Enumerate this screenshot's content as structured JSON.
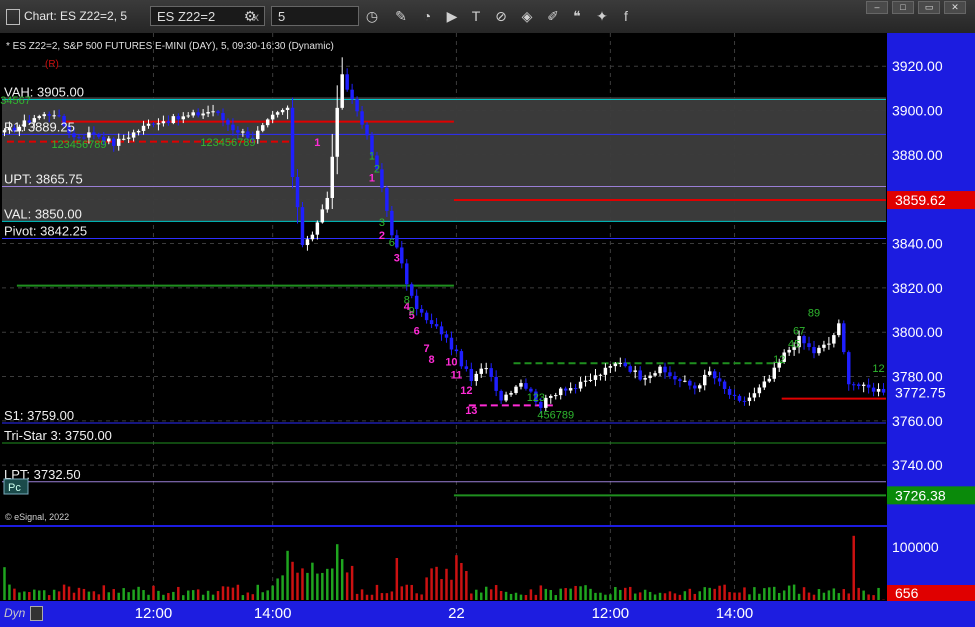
{
  "window": {
    "title": "Chart: ES Z22=2, 5",
    "symbol_field": "ES Z22=2",
    "interval_field": "5",
    "close_x": "x"
  },
  "header": {
    "description": "* ES Z22=2, S&P 500 FUTURES E-MINI (DAY), 5, 09:30-16:30 (Dynamic)",
    "r_marker": "(R)",
    "copyright": "© eSignal, 2022",
    "pc_button": "Pc"
  },
  "status": {
    "dyn_label": "Dyn"
  },
  "colors": {
    "background": "#000000",
    "axis_blue": "#1c1ce0",
    "price_red": "#e00000",
    "price_green": "#0a8a0a",
    "candle_up": "#ffffff",
    "candle_down": "#1f1fff",
    "green_label": "#2fb82f",
    "magenta_label": "#ff2bd6"
  },
  "chart_data": {
    "type": "candlestick",
    "ylim": [
      3713,
      3935
    ],
    "volume_ylim": [
      0,
      120000
    ],
    "y_ticks": [
      3920,
      3900,
      3880,
      3860,
      3840,
      3820,
      3800,
      3780,
      3760,
      3740
    ],
    "y_tick_labels": [
      "3920.00",
      "3900.00",
      "3880.00",
      "3840.00",
      "3820.00",
      "3800.00",
      "3780.00",
      "3760.00",
      "3740.00"
    ],
    "volume_tick_label": "100000",
    "x_labels": [
      {
        "label": "12:00",
        "bar": 30
      },
      {
        "label": "14:00",
        "bar": 54
      },
      {
        "label": "22",
        "bar": 91
      },
      {
        "label": "12:00",
        "bar": 122
      },
      {
        "label": "14:00",
        "bar": 147
      }
    ],
    "session_break_bar": 91,
    "n_bars": 178,
    "last_price": "3859.62",
    "last_price_value": 3859.62,
    "low_price": "3726.38",
    "low_price_value": 3726.38,
    "current_price": "3772.75",
    "current_price_value": 3772.75,
    "current_volume": "656",
    "anchors": [
      [
        0,
        3890
      ],
      [
        3,
        3893
      ],
      [
        6,
        3897
      ],
      [
        10,
        3899
      ],
      [
        14,
        3888
      ],
      [
        18,
        3890
      ],
      [
        22,
        3885
      ],
      [
        26,
        3890
      ],
      [
        30,
        3895
      ],
      [
        34,
        3896
      ],
      [
        38,
        3898
      ],
      [
        42,
        3900
      ],
      [
        46,
        3892
      ],
      [
        50,
        3888
      ],
      [
        54,
        3897
      ],
      [
        57,
        3901
      ],
      [
        58,
        3870
      ],
      [
        60,
        3840
      ],
      [
        62,
        3845
      ],
      [
        65,
        3860
      ],
      [
        67,
        3900
      ],
      [
        68,
        3915
      ],
      [
        70,
        3905
      ],
      [
        72,
        3895
      ],
      [
        74,
        3880
      ],
      [
        76,
        3865
      ],
      [
        78,
        3845
      ],
      [
        80,
        3830
      ],
      [
        82,
        3815
      ],
      [
        85,
        3805
      ],
      [
        88,
        3800
      ],
      [
        91,
        3790
      ],
      [
        94,
        3778
      ],
      [
        97,
        3785
      ],
      [
        100,
        3770
      ],
      [
        104,
        3778
      ],
      [
        108,
        3767
      ],
      [
        112,
        3775
      ],
      [
        115,
        3775
      ],
      [
        119,
        3780
      ],
      [
        124,
        3787
      ],
      [
        128,
        3780
      ],
      [
        132,
        3783
      ],
      [
        136,
        3778
      ],
      [
        139,
        3775
      ],
      [
        142,
        3782
      ],
      [
        145,
        3774
      ],
      [
        148,
        3768
      ],
      [
        151,
        3772
      ],
      [
        154,
        3779
      ],
      [
        157,
        3790
      ],
      [
        160,
        3797
      ],
      [
        163,
        3791
      ],
      [
        166,
        3795
      ],
      [
        168,
        3803
      ],
      [
        170,
        3778
      ],
      [
        173,
        3775
      ],
      [
        176,
        3774
      ],
      [
        177,
        3772.75
      ]
    ],
    "levels": [
      {
        "name": "VAH",
        "label": "VAH: 3905.00",
        "value": 3905.0,
        "color": "#00c8c8",
        "label_side": "left"
      },
      {
        "name": "R1",
        "label": "R1: 3889.25",
        "value": 3889.25,
        "color": "#2d2dff",
        "label_side": "left"
      },
      {
        "name": "UPT",
        "label": "UPT: 3865.75",
        "value": 3865.75,
        "color": "#9a7fd6",
        "label_side": "left"
      },
      {
        "name": "VAL",
        "label": "VAL: 3850.00",
        "value": 3850.0,
        "color": "#00c8c8",
        "label_side": "left"
      },
      {
        "name": "Pivot",
        "label": "Pivot: 3842.25",
        "value": 3842.25,
        "color": "#2d2dff",
        "label_side": "left"
      },
      {
        "name": "S1",
        "label": "S1: 3759.00",
        "value": 3759.0,
        "color": "#2d2dff",
        "label_side": "left"
      },
      {
        "name": "TriStar",
        "label": "Tri-Star 3: 3750.00",
        "value": 3750.0,
        "color": "#1f8f1f",
        "label_side": "left"
      },
      {
        "name": "LPT",
        "label": "LPT: 3732.50",
        "value": 3732.5,
        "color": "#9a7fd6",
        "label_side": "left"
      }
    ],
    "segments": [
      {
        "value": 3895,
        "from_bar": 12,
        "to_bar": 91,
        "color": "#e00000",
        "dash": false
      },
      {
        "value": 3886,
        "from_bar": 1,
        "to_bar": 58,
        "color": "#e00000",
        "dash": true
      },
      {
        "value": 3859.62,
        "from_bar": 91,
        "to_bar": 178,
        "color": "#e00000",
        "dash": false
      },
      {
        "value": 3821,
        "from_bar": 3,
        "to_bar": 91,
        "color": "#1f8f1f",
        "dash": false
      },
      {
        "value": 3786,
        "from_bar": 103,
        "to_bar": 157,
        "color": "#1f8f1f",
        "dash": true
      },
      {
        "value": 3767,
        "from_bar": 94,
        "to_bar": 111,
        "color": "#ff2bd6",
        "dash": true
      },
      {
        "value": 3770,
        "from_bar": 157,
        "to_bar": 178,
        "color": "#e00000",
        "dash": false
      },
      {
        "value": 3726.38,
        "from_bar": 91,
        "to_bar": 178,
        "color": "#1f8f1f",
        "dash": false
      }
    ],
    "seq_labels": [
      {
        "text": "1",
        "bar": 63,
        "value": 3884,
        "color": "#ff2bd6"
      },
      {
        "text": "1",
        "bar": 74,
        "value": 3868,
        "color": "#ff2bd6"
      },
      {
        "text": "2",
        "bar": 76,
        "value": 3842,
        "color": "#ff2bd6"
      },
      {
        "text": "3",
        "bar": 79,
        "value": 3832,
        "color": "#ff2bd6"
      },
      {
        "text": "4",
        "bar": 81,
        "value": 3810,
        "color": "#ff2bd6"
      },
      {
        "text": "5",
        "bar": 82,
        "value": 3806,
        "color": "#ff2bd6"
      },
      {
        "text": "6",
        "bar": 83,
        "value": 3799,
        "color": "#ff2bd6"
      },
      {
        "text": "7",
        "bar": 85,
        "value": 3791,
        "color": "#ff2bd6"
      },
      {
        "text": "8",
        "bar": 86,
        "value": 3786,
        "color": "#ff2bd6"
      },
      {
        "text": "10",
        "bar": 90,
        "value": 3785,
        "color": "#ff2bd6"
      },
      {
        "text": "11",
        "bar": 91,
        "value": 3779,
        "color": "#ff2bd6"
      },
      {
        "text": "12",
        "bar": 93,
        "value": 3772,
        "color": "#ff2bd6"
      },
      {
        "text": "13",
        "bar": 94,
        "value": 3763,
        "color": "#ff2bd6"
      },
      {
        "text": "1",
        "bar": 74,
        "value": 3878,
        "color": "#2fb82f"
      },
      {
        "text": "2",
        "bar": 75,
        "value": 3872,
        "color": "#2fb82f"
      },
      {
        "text": "3",
        "bar": 76,
        "value": 3848,
        "color": "#2fb82f"
      },
      {
        "text": "6",
        "bar": 78,
        "value": 3839,
        "color": "#2fb82f"
      },
      {
        "text": "8",
        "bar": 81,
        "value": 3813,
        "color": "#2fb82f"
      },
      {
        "text": "9",
        "bar": 82,
        "value": 3808,
        "color": "#2fb82f"
      },
      {
        "text": "123",
        "bar": 107,
        "value": 3769,
        "color": "#2fb82f"
      },
      {
        "text": "456789",
        "bar": 111,
        "value": 3761,
        "color": "#2fb82f"
      },
      {
        "text": "12",
        "bar": 156,
        "value": 3786,
        "color": "#2fb82f"
      },
      {
        "text": "45",
        "bar": 159,
        "value": 3793,
        "color": "#2fb82f"
      },
      {
        "text": "67",
        "bar": 160,
        "value": 3799,
        "color": "#2fb82f"
      },
      {
        "text": "89",
        "bar": 163,
        "value": 3807,
        "color": "#2fb82f"
      },
      {
        "text": "12",
        "bar": 176,
        "value": 3782,
        "color": "#2fb82f"
      },
      {
        "text": "123456789",
        "bar": 15,
        "value": 3883,
        "color": "#2fb82f"
      },
      {
        "text": "123456789",
        "bar": 45,
        "value": 3884,
        "color": "#2fb82f"
      },
      {
        "text": "1234567",
        "bar": 1,
        "value": 3903,
        "color": "#2fb82f"
      }
    ]
  }
}
